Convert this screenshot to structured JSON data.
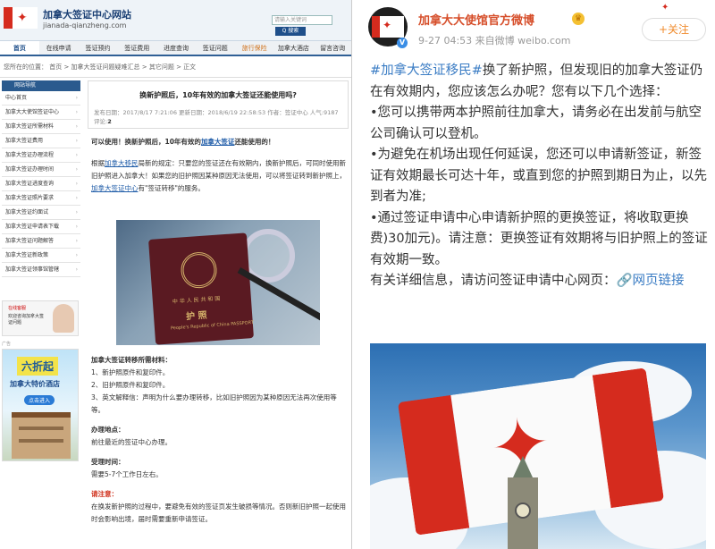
{
  "left": {
    "site_title": "加拿大签证中心网站",
    "site_url": "jianada-qianzheng.com",
    "search_placeholder": "请输入关键词",
    "search_button": "Q 搜索",
    "nav": [
      "首页",
      "在线申请",
      "签证预约",
      "签证费用",
      "进度查询",
      "签证问题",
      "旅行保险",
      "加拿大酒店",
      "留言咨询"
    ],
    "breadcrumb": "您所在的位置： 首页 > 加拿大签证问题疑难汇总 > 其它问题 > 正文",
    "sidebar_head": "网站导航",
    "sidebar_items": [
      "中心首页",
      "加拿大大使馆签证中心",
      "加拿大签证所需材料",
      "加拿大签证费用",
      "加拿大签证办理流程",
      "加拿大签证办理时间",
      "加拿大签证进度查询",
      "加拿大签证照片要求",
      "加拿大签证约面试",
      "加拿大签证申请表下载",
      "加拿大签证问题解答",
      "加拿大签证新政策",
      "加拿大签证领事馆管辖"
    ],
    "promo_line1": "在线客服",
    "promo_line2": "欢迎咨询加拿大签证问题",
    "ad_caption": "广告",
    "ad_big": "六折起",
    "ad_mid": "加拿大特价酒店",
    "ad_btn": "点击进入",
    "article": {
      "title": "换新护照后，10年有效的加拿大签证还能使用吗?",
      "meta_publish": "发布日期：2017/8/17 7:21:06",
      "meta_update": "更新日期：2018/6/19 22:58:53",
      "meta_author": "作者：签证中心",
      "meta_views": "人气:9187",
      "meta_comments_label": "评论:",
      "meta_comments_count": "2",
      "lead_pre": "可以使用！换新护照后，10年有效的",
      "lead_link": "加拿大签证",
      "lead_post": "还能使用的！",
      "p1_a": "根据",
      "p1_link1": "加拿大移民",
      "p1_b": "局新的规定：只要您的签证还在有效期内，换新护照后，可同时使用新旧护照进入加拿大！如果您的旧护照因某种原因无法使用，可以将签证转到新护照上，",
      "p1_link2": "加拿大签证中心",
      "p1_c": "有\"签证转移\"的服务。",
      "passport_cn": "中 华 人 民 共 和 国",
      "passport_hz": "护  照",
      "passport_en": "People's Republic of China  PASSPORT",
      "materials_title": "加拿大签证转移所需材料：",
      "materials": [
        "1、新护照原件和复印件。",
        "2、旧护照原件和复印件。",
        "3、英文解释信：声明为什么要办理转移，比如旧护照因为某种原因无法再次使用等等。"
      ],
      "location_title": "办理地点：",
      "location": "前往最近的签证中心办理。",
      "time_title": "受理时间：",
      "time": "需要5-7个工作日左右。",
      "note_title": "请注意：",
      "note": "在换发新护照的过程中，要避免有效的签证页发生破损等情况。否则新旧护照一起使用时会影响出境，届时需要重新申请签证。"
    }
  },
  "right": {
    "name": "加拿大大使馆官方微博",
    "crown_icon": "♛",
    "time": "9-27 04:53  来自微博 weibo.com",
    "follow": "+关注",
    "tag": "#加拿大签证移民#",
    "text_main": "换了新护照，但发现旧的加拿大签证仍在有效期内，您应该怎么办呢？您有以下几个选择：",
    "bullet1": "•您可以携带两本护照前往加拿大，请务必在出发前与航空公司确认可以登机。",
    "bullet2": "•为避免在机场出现任何延误，您还可以申请新签证，新签证有效期最长可达十年，或直到您的护照到期日为止，以先到者为准;",
    "bullet3": "•通过签证申请中心申请新护照的更换签证，将收取更换费)30加元)。请注意：更换签证有效期将与旧护照上的签证有效期一致。",
    "closing": "有关详细信息，请访问签证申请中心网页：",
    "link": "🔗网页链接"
  },
  "colors": {
    "weibo_name": "#d64e2a",
    "weibo_link": "#3a7cc4",
    "canada_red": "#d52b1e",
    "nav_blue": "#1f4f8a"
  }
}
